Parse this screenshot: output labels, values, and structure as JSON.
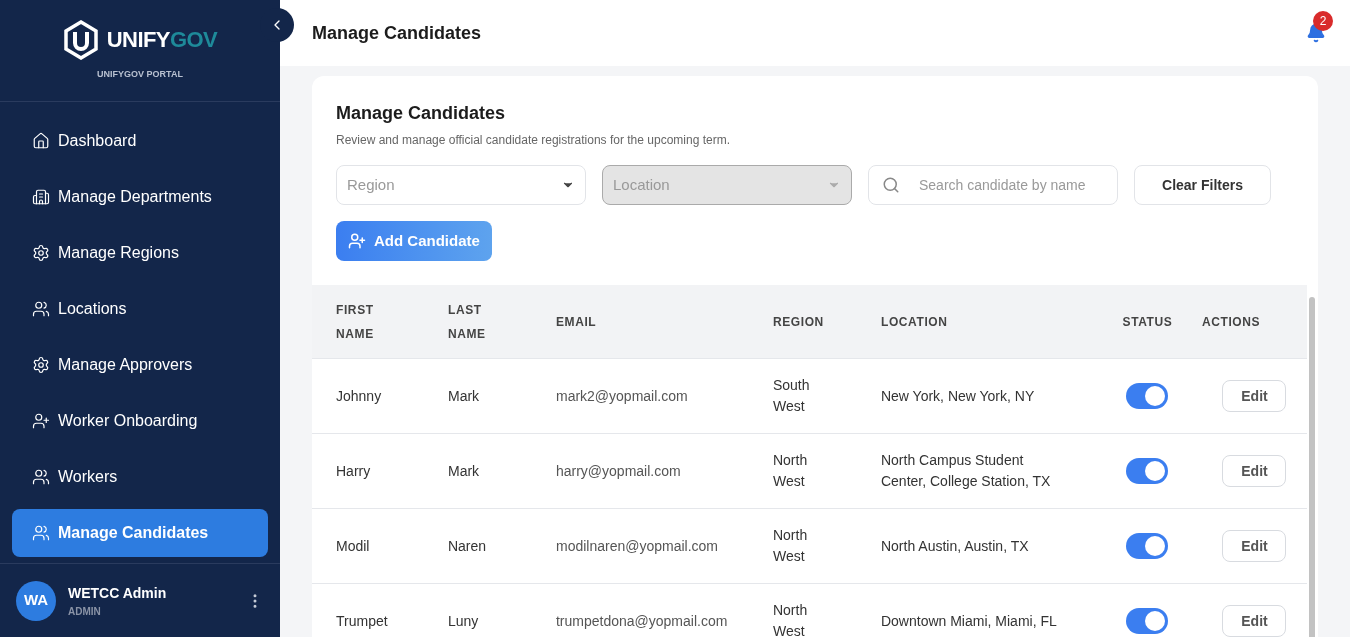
{
  "brand": {
    "name_a": "UNIFY",
    "name_b": "GOV",
    "subtitle": "UNIFYGOV PORTAL"
  },
  "nav": [
    {
      "label": "Dashboard",
      "kind": "home",
      "selected": false
    },
    {
      "label": "Manage Departments",
      "kind": "building",
      "selected": false
    },
    {
      "label": "Manage Regions",
      "kind": "gear",
      "selected": false
    },
    {
      "label": "Locations",
      "kind": "user",
      "selected": false
    },
    {
      "label": "Manage Approvers",
      "kind": "gear",
      "selected": false
    },
    {
      "label": "Worker Onboarding",
      "kind": "user-plus",
      "selected": false
    },
    {
      "label": "Workers",
      "kind": "user",
      "selected": false
    },
    {
      "label": "Manage Candidates",
      "kind": "user",
      "selected": true
    }
  ],
  "user": {
    "initials": "WA",
    "name": "WETCC Admin",
    "role": "ADMIN"
  },
  "header": {
    "title": "Manage Candidates",
    "notifications": "2"
  },
  "card": {
    "title": "Manage Candidates",
    "subtitle": "Review and manage official candidate registrations for the upcoming term."
  },
  "filters": {
    "region": {
      "placeholder": "Region",
      "disabled": false
    },
    "location": {
      "placeholder": "Location",
      "disabled": true
    },
    "search": {
      "placeholder": "Search candidate by name"
    },
    "clear": "Clear Filters"
  },
  "add_button": "Add Candidate",
  "table": {
    "columns": [
      "FIRST NAME",
      "LAST NAME",
      "EMAIL",
      "REGION",
      "LOCATION",
      "STATUS",
      "ACTIONS"
    ],
    "rows": [
      {
        "first": "Johnny",
        "last": "Mark",
        "email": "mark2@yopmail.com",
        "region": "South West",
        "location": "New York, New York, NY",
        "on": true,
        "action": "Edit"
      },
      {
        "first": "Harry",
        "last": "Mark",
        "email": "harry@yopmail.com",
        "region": "North West",
        "location": "North Campus Student Center, College Station, TX",
        "on": true,
        "action": "Edit"
      },
      {
        "first": "Modil",
        "last": "Naren",
        "email": "modilnaren@yopmail.com",
        "region": "North West",
        "location": "North Austin, Austin, TX",
        "on": true,
        "action": "Edit"
      },
      {
        "first": "Trumpet",
        "last": "Luny",
        "email": "trumpetdona@yopmail.com",
        "region": "North West",
        "location": "Downtown Miami, Miami, FL",
        "on": true,
        "action": "Edit"
      }
    ]
  }
}
